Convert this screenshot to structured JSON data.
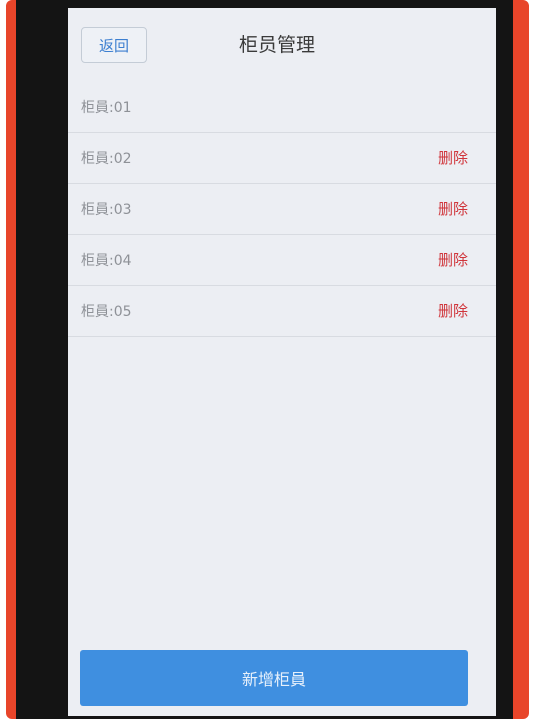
{
  "header": {
    "back_label": "返回",
    "title": "柜员管理"
  },
  "list": {
    "rows": [
      {
        "label": "柜員:01",
        "delete_label": ""
      },
      {
        "label": "柜員:02",
        "delete_label": "删除"
      },
      {
        "label": "柜員:03",
        "delete_label": "删除"
      },
      {
        "label": "柜員:04",
        "delete_label": "删除"
      },
      {
        "label": "柜員:05",
        "delete_label": "删除"
      }
    ]
  },
  "footer": {
    "add_label": "新增柜員"
  },
  "colors": {
    "accent": "#3f8fe0",
    "delete": "#d0343a",
    "device": "#e8452a"
  }
}
